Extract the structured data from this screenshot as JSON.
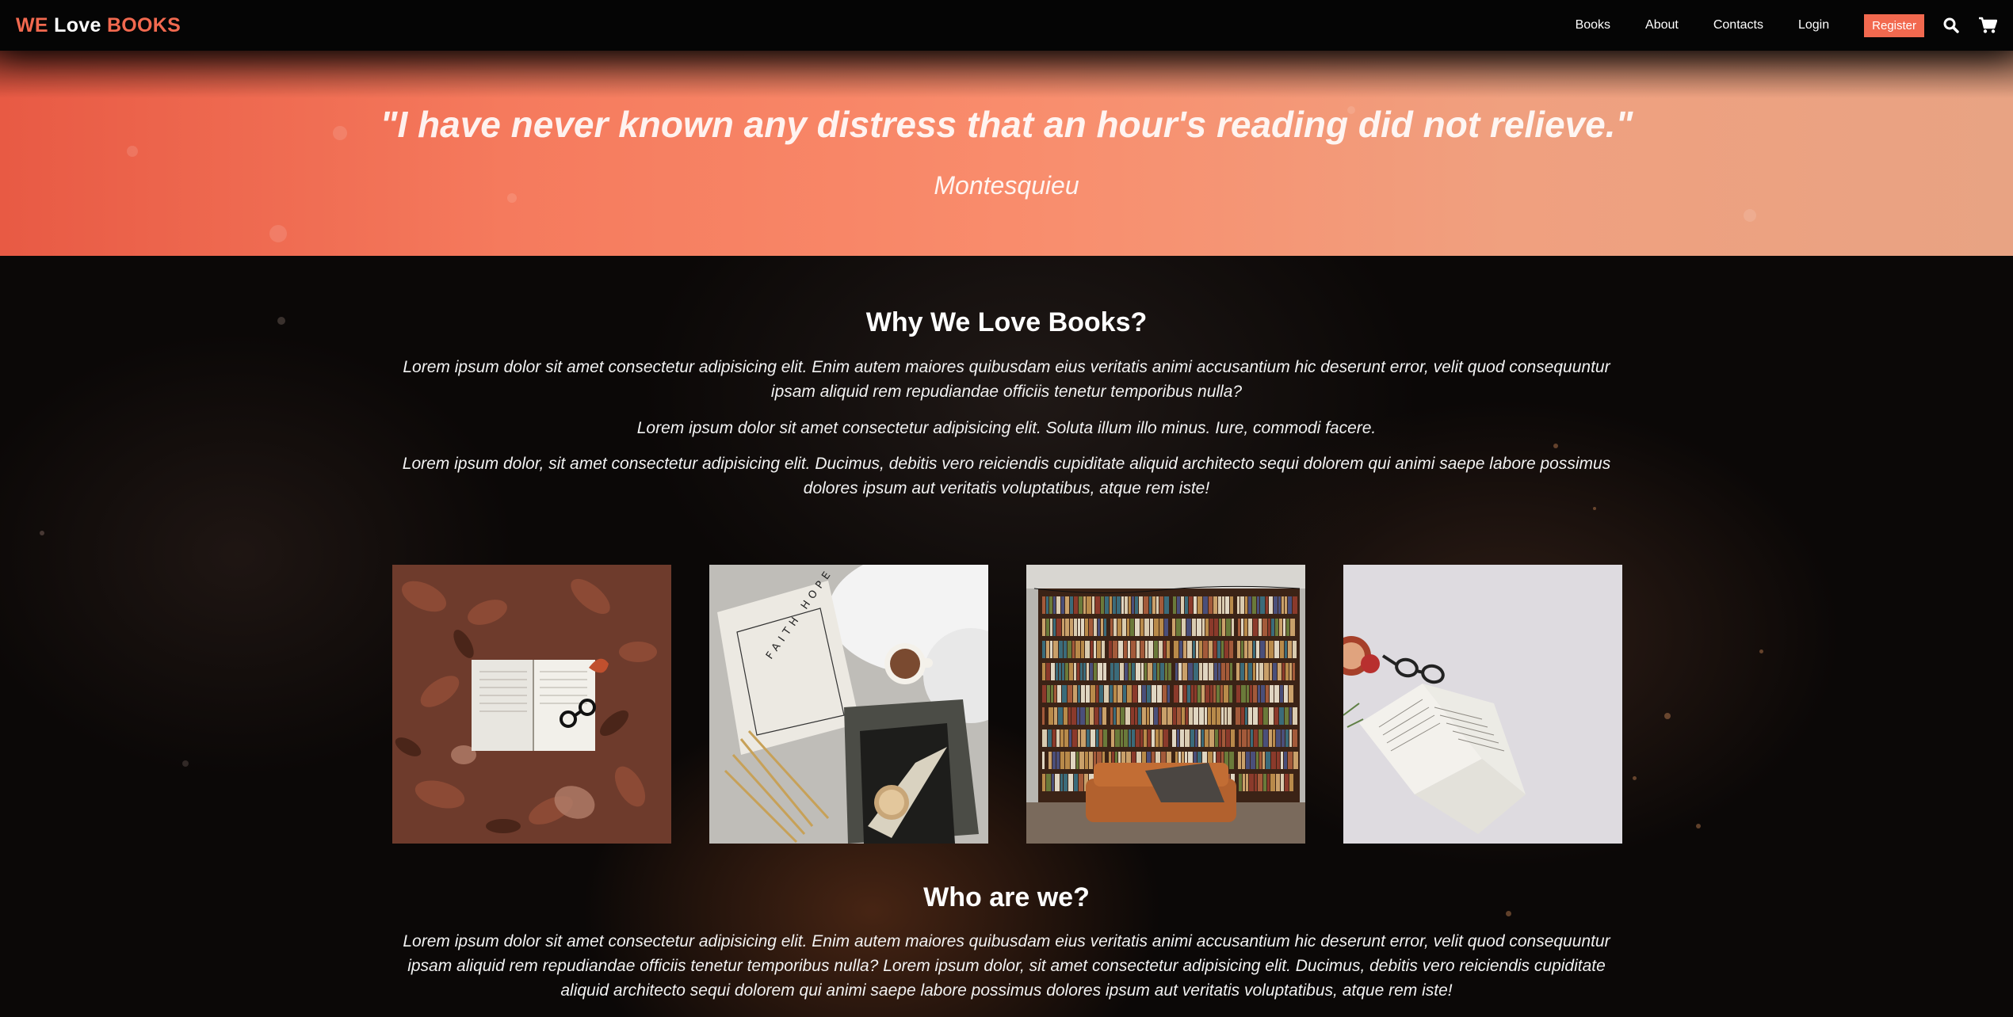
{
  "brand": {
    "part1": "WE",
    "part2": "Love",
    "part3": "BOOKS"
  },
  "nav": {
    "links": [
      "Books",
      "About",
      "Contacts",
      "Login"
    ],
    "register": "Register",
    "icons": [
      "search-icon",
      "cart-icon"
    ]
  },
  "hero": {
    "quote": "\"I have never known any distress that an hour's reading did not relieve.\"",
    "author": "Montesquieu"
  },
  "why": {
    "title": "Why We Love Books?",
    "paragraphs": [
      "Lorem ipsum dolor sit amet consectetur adipisicing elit. Enim autem maiores quibusdam eius veritatis animi accusantium hic deserunt error, velit quod consequuntur ipsam aliquid rem repudiandae officiis tenetur temporibus nulla?",
      "Lorem ipsum dolor sit amet consectetur adipisicing elit. Soluta illum illo minus. Iure, commodi facere.",
      "Lorem ipsum dolor, sit amet consectetur adipisicing elit. Ducimus, debitis vero reiciendis cupiditate aliquid architecto sequi dolorem qui animi saepe labore possimus dolores ipsum aut veritatis voluptatibus, atque rem iste!"
    ]
  },
  "photos": [
    {
      "name": "book-on-autumn-leaves-image",
      "text": ""
    },
    {
      "name": "faith-hope-love-book-image",
      "text": "FAITH HOPE LOVE"
    },
    {
      "name": "library-bookshelf-image",
      "text": ""
    },
    {
      "name": "open-book-with-glasses-image",
      "text": ""
    }
  ],
  "who": {
    "title": "Who are we?",
    "paragraph": "Lorem ipsum dolor sit amet consectetur adipisicing elit. Enim autem maiores quibusdam eius veritatis animi accusantium hic deserunt error, velit quod consequuntur ipsam aliquid rem repudiandae officiis tenetur temporibus nulla? Lorem ipsum dolor, sit amet consectetur adipisicing elit. Ducimus, debitis vero reiciendis cupiditate aliquid architecto sequi dolorem qui animi saepe labore possimus dolores ipsum aut veritatis voluptatibus, atque rem iste!"
  },
  "colors": {
    "accent": "#f2694f",
    "navbar": "#050505",
    "background": "#0a0706"
  }
}
